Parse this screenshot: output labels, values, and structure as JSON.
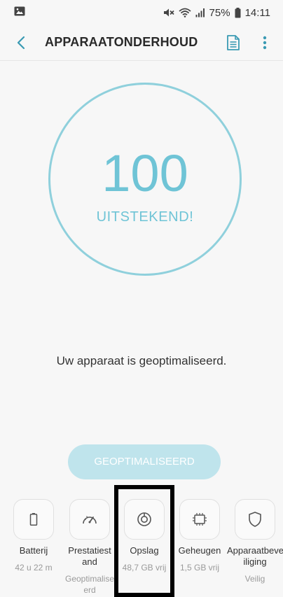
{
  "status_bar": {
    "battery_percent": "75%",
    "time": "14:11"
  },
  "header": {
    "title": "APPARAATONDERHOUD"
  },
  "score": {
    "value": "100",
    "label": "UITSTEKEND!"
  },
  "message": "Uw apparaat is geoptimaliseerd.",
  "optimize_button": {
    "label": "GEOPTIMALISEERD"
  },
  "items": [
    {
      "name": "Batterij",
      "sub": "42 u 22 m",
      "icon": "battery-icon"
    },
    {
      "name": "Prestatiest and",
      "sub": "Geoptimalise erd",
      "icon": "speedometer-icon"
    },
    {
      "name": "Opslag",
      "sub": "48,7 GB vrij",
      "icon": "storage-icon"
    },
    {
      "name": "Geheugen",
      "sub": "1,5 GB vrij",
      "icon": "memory-chip-icon"
    },
    {
      "name": "Apparaatbeve iliging",
      "sub": "Veilig",
      "icon": "shield-icon"
    }
  ],
  "colors": {
    "accent": "#6fc4d6",
    "button_bg": "#bfe4ec",
    "background": "#f7f7f7"
  }
}
